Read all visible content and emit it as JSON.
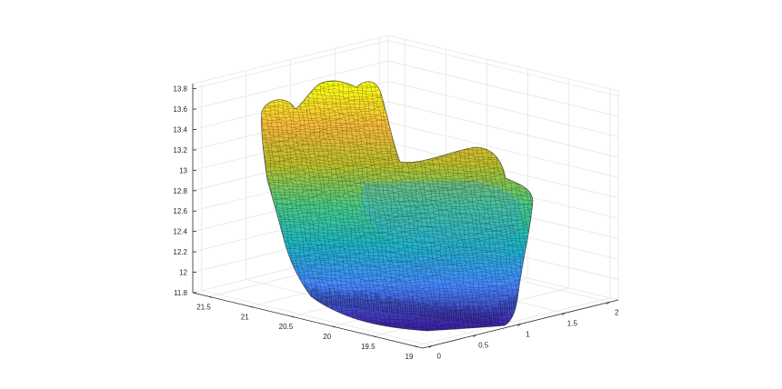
{
  "chart_data": {
    "type": "surface",
    "title": "",
    "xlabel": "",
    "ylabel": "",
    "zlabel": "",
    "grid": true,
    "colormap": "parula",
    "colorscale": [
      "#3e26a8",
      "#4689fd",
      "#1eb5c7",
      "#48cb86",
      "#b8bf2c",
      "#f5b93b",
      "#f9fb15"
    ],
    "axes": {
      "x": {
        "range": [
          18.9,
          21.7
        ],
        "ticks": [
          19,
          19.5,
          20,
          20.5,
          21,
          21.5
        ],
        "tick_labels": [
          "19",
          "19.5",
          "20",
          "20.5",
          "21",
          "21.5"
        ]
      },
      "y": {
        "range": [
          -0.1,
          2.1
        ],
        "ticks": [
          0,
          0.5,
          1,
          1.5,
          2
        ],
        "tick_labels": [
          "0",
          "0.5",
          "1",
          "1.5",
          "2"
        ]
      },
      "z": {
        "range": [
          11.8,
          13.85
        ],
        "ticks": [
          11.8,
          12,
          12.2,
          12.4,
          12.6,
          12.8,
          13,
          13.2,
          13.4,
          13.6,
          13.8
        ],
        "tick_labels": [
          "11.8",
          "12",
          "12.2",
          "12.4",
          "12.6",
          "12.8",
          "13",
          "13.2",
          "13.4",
          "13.6",
          "13.8"
        ]
      }
    },
    "surface_extent": {
      "z_min": 11.85,
      "z_max": 13.82
    }
  }
}
